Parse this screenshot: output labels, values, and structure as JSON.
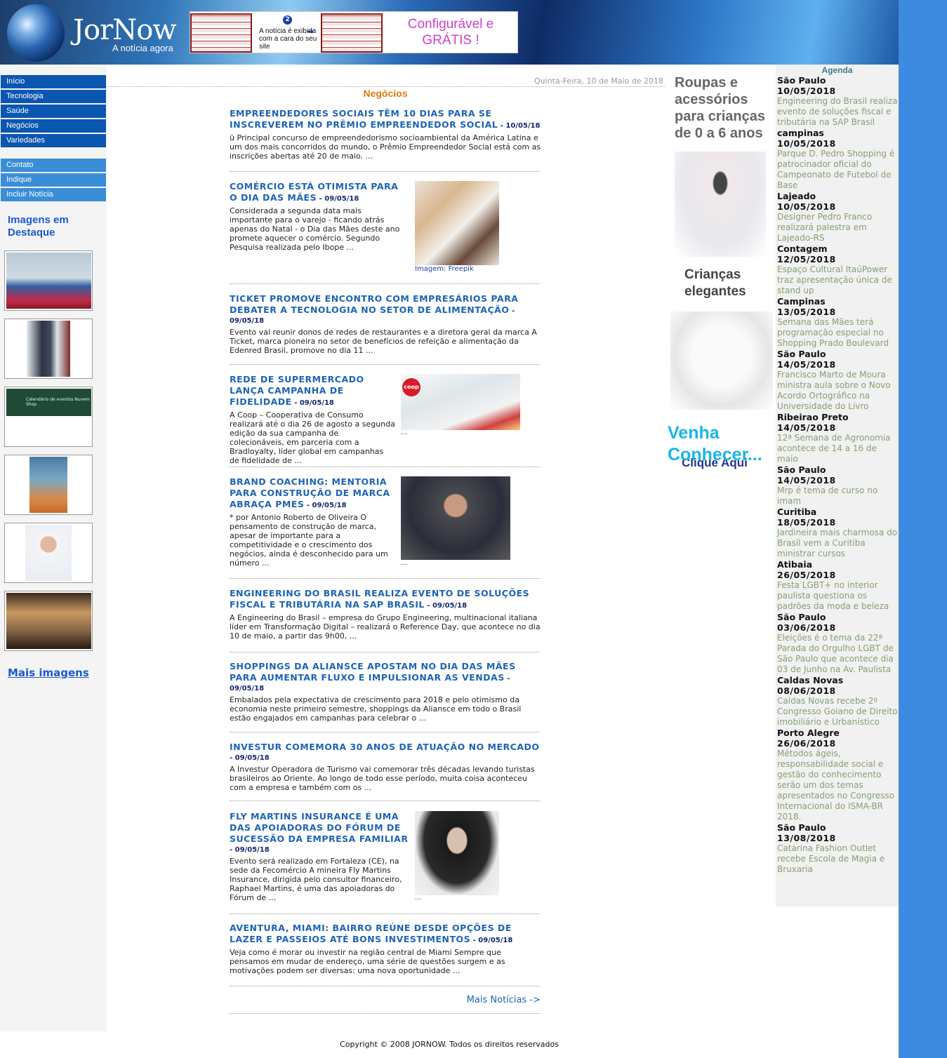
{
  "header": {
    "logo": "JorNow",
    "tagline": "A notícia agora",
    "ad": {
      "badge": "2",
      "text": "A notícia é exibida com a cara do seu site",
      "free": "Configurável e GRÁTIS !"
    }
  },
  "nav": {
    "main": [
      "Início",
      "Tecnologia",
      "Saúde",
      "Negócios",
      "Variedades"
    ],
    "secondary": [
      "Contato",
      "Indique",
      "Incluir Notícia"
    ]
  },
  "featured": {
    "title": "Imagens em Destaque",
    "more": "Mais imagens",
    "thumb3_caption": "Calendário de eventos Nuvem Shop"
  },
  "date": "Quinta-Feira, 10 de Maio de 2018",
  "section": "Negócios",
  "articles": [
    {
      "title": "EMPREENDEDORES SOCIAIS TÊM 10 DIAS PARA SE INSCREVEREM NO PRÊMIO EMPREENDEDOR SOCIAL",
      "date": "10/05/18",
      "text": "ü Principal concurso de empreendedorismo socioambiental da América Latina e um dos mais concorridos do mundo, o Prêmio Empreendedor Social está com as inscrições abertas até 20 de maio. ..."
    },
    {
      "title": "COMÉRCIO ESTÁ OTIMISTA PARA O DIA DAS MÃES",
      "date": "09/05/18",
      "text": "Considerada a segunda data mais importante para o varejo - ficando atrás apenas do Natal - o Dia das Mães deste ano promete aquecer o comércio. Segundo Pesquisa realizada pelo Ibope ...",
      "caption": "Imagem: Freepik"
    },
    {
      "title": "TICKET PROMOVE ENCONTRO COM EMPRESÁRIOS PARA DEBATER A TECNOLOGIA NO SETOR DE ALIMENTAÇÃO",
      "date": "09/05/18",
      "text": "Evento vai reunir donos de redes de restaurantes e a diretora geral da marca A Ticket, marca pioneira no setor de benefícios de refeição e alimentação da Edenred Brasil, promove no dia 11 ..."
    },
    {
      "title": "REDE DE SUPERMERCADO LANÇA CAMPANHA DE FIDELIDADE",
      "date": "09/05/18",
      "text": "A Coop – Cooperativa de Consumo realizará até o dia 26 de agosto a segunda edição da sua campanha de colecionáveis, em parceria com a Bradloyalty, líder global em campanhas de fidelidade de ...",
      "caption": "...",
      "img_label": "coop"
    },
    {
      "title": "BRAND COACHING: MENTORIA PARA CONSTRUÇÃO DE MARCA ABRAÇA PMES",
      "date": "09/05/18",
      "text": "* por Antonio Roberto de Oliveira O pensamento de construção de marca, apesar de importante para a competitividade e o crescimento dos negócios, ainda é desconhecido para um número ...",
      "caption": "..."
    },
    {
      "title": "ENGINEERING DO BRASIL REALIZA EVENTO DE SOLUÇÕES FISCAL E TRIBUTÁRIA NA SAP BRASIL",
      "date": "09/05/18",
      "text": "A Engineering do Brasil – empresa do Grupo Engineering, multinacional italiana líder em Transformação Digital – realizará o Reference Day, que acontece no dia 10 de maio, a partir das 9h00, ..."
    },
    {
      "title": "SHOPPINGS DA ALIANSCE APOSTAM NO DIA DAS MÃES PARA AUMENTAR FLUXO E IMPULSIONAR AS VENDAS",
      "date": "09/05/18",
      "text": "Embalados pela expectativa de crescimento para 2018 e pelo otimismo da economia neste primeiro semestre, shoppings da Aliansce em todo o Brasil estão engajados em campanhas para celebrar o ..."
    },
    {
      "title": "INVESTUR COMEMORA 30 ANOS DE ATUAÇÃO NO MERCADO",
      "date": "09/05/18",
      "text": "A Investur Operadora de Turismo vai comemorar três décadas levando turistas brasileiros ao Oriente. Ao longo de todo esse período, muita coisa aconteceu com a empresa e também com os ..."
    },
    {
      "title": "FLY MARTINS INSURANCE É UMA DAS APOIADORAS DO FÓRUM DE SUCESSÃO DA EMPRESA FAMILIAR",
      "date": "09/05/18",
      "text": "Evento será realizado em Fortaleza (CE), na sede da Fecomércio A mineira Fly Martins Insurance, dirigida pelo consultor financeiro, Raphael Martins, é uma das apoiadoras do Fórum de ...",
      "caption": "..."
    },
    {
      "title": "AVENTURA, MIAMI: BAIRRO REÚNE DESDE OPÇÕES DE LAZER E PASSEIOS ATÉ BONS INVESTIMENTOS",
      "date": "09/05/18",
      "text": "Veja como é morar ou investir na região central de Miami Sempre que pensamos em mudar de endereço, uma série de questões surgem e as motivações podem ser diversas: uma nova oportunidade ..."
    }
  ],
  "more_news": "Mais Notícias ->",
  "copyright": "Copyright © 2008 JORNOW. Todos os direitos reservados",
  "side_ad": {
    "line1": "Roupas e acessórios para crianças de 0 a 6 anos",
    "line2": "Crianças elegantes",
    "line3": "Venha Conhecer...",
    "line4": "Clique Aqui"
  },
  "agenda": {
    "title": "Agenda",
    "events": [
      {
        "city": "São Paulo",
        "date": "10/05/2018",
        "text": "Engineering do Brasil realiza evento de soluções fiscal e tributária na SAP Brasil"
      },
      {
        "city": "campinas",
        "date": "10/05/2018",
        "text": "Parque D. Pedro Shopping é patrocinador oficial do Campeonato de Futebol de Base"
      },
      {
        "city": "Lajeado",
        "date": "10/05/2018",
        "text": "Designer Pedro Franco realizará palestra em Lajeado-RS"
      },
      {
        "city": "Contagem",
        "date": "12/05/2018",
        "text": "Espaço Cultural ItaúPower traz apresentação única de stand up"
      },
      {
        "city": "Campinas",
        "date": "13/05/2018",
        "text": "Semana das Mães terá programação especial no Shopping Prado Boulevard"
      },
      {
        "city": "São Paulo",
        "date": "14/05/2018",
        "text": "Francisco Marto de Moura ministra aula sobre o Novo Acordo Ortográfico na Universidade do Livro"
      },
      {
        "city": "Ribeirao Preto",
        "date": "14/05/2018",
        "text": "12ª Semana de Agronomia acontece de 14 a 16 de maio"
      },
      {
        "city": "São Paulo",
        "date": "14/05/2018",
        "text": "Mrp é tema de curso no imam"
      },
      {
        "city": "Curitiba",
        "date": "18/05/2018",
        "text": "Jardineira mais charmosa do Brasil vem a Curitiba ministrar cursos"
      },
      {
        "city": "Atibaia",
        "date": "26/05/2018",
        "text": "Festa LGBT+ no interior paulista questiona os padrões da moda e beleza"
      },
      {
        "city": "São Paulo",
        "date": "03/06/2018",
        "text": "Eleições é o tema da 22ª Parada do Orgulho LGBT de São Paulo que acontece dia 03 de Junho na Av. Paulista"
      },
      {
        "city": "Caldas Novas",
        "date": "08/06/2018",
        "text": "Caldas Novas recebe 2º Congresso Goiano de Direito imobiliário e Urbanístico"
      },
      {
        "city": "Porto Alegre",
        "date": "26/06/2018",
        "text": "Métodos ágeis, responsabilidade social e gestão do conhecimento serão um dos temas apresentados no Congresso Internacional do ISMA-BR 2018."
      },
      {
        "city": "São Paulo",
        "date": "13/08/2018",
        "text": "Catarina Fashion Outlet recebe Escola de Magia e Bruxaria"
      }
    ]
  }
}
